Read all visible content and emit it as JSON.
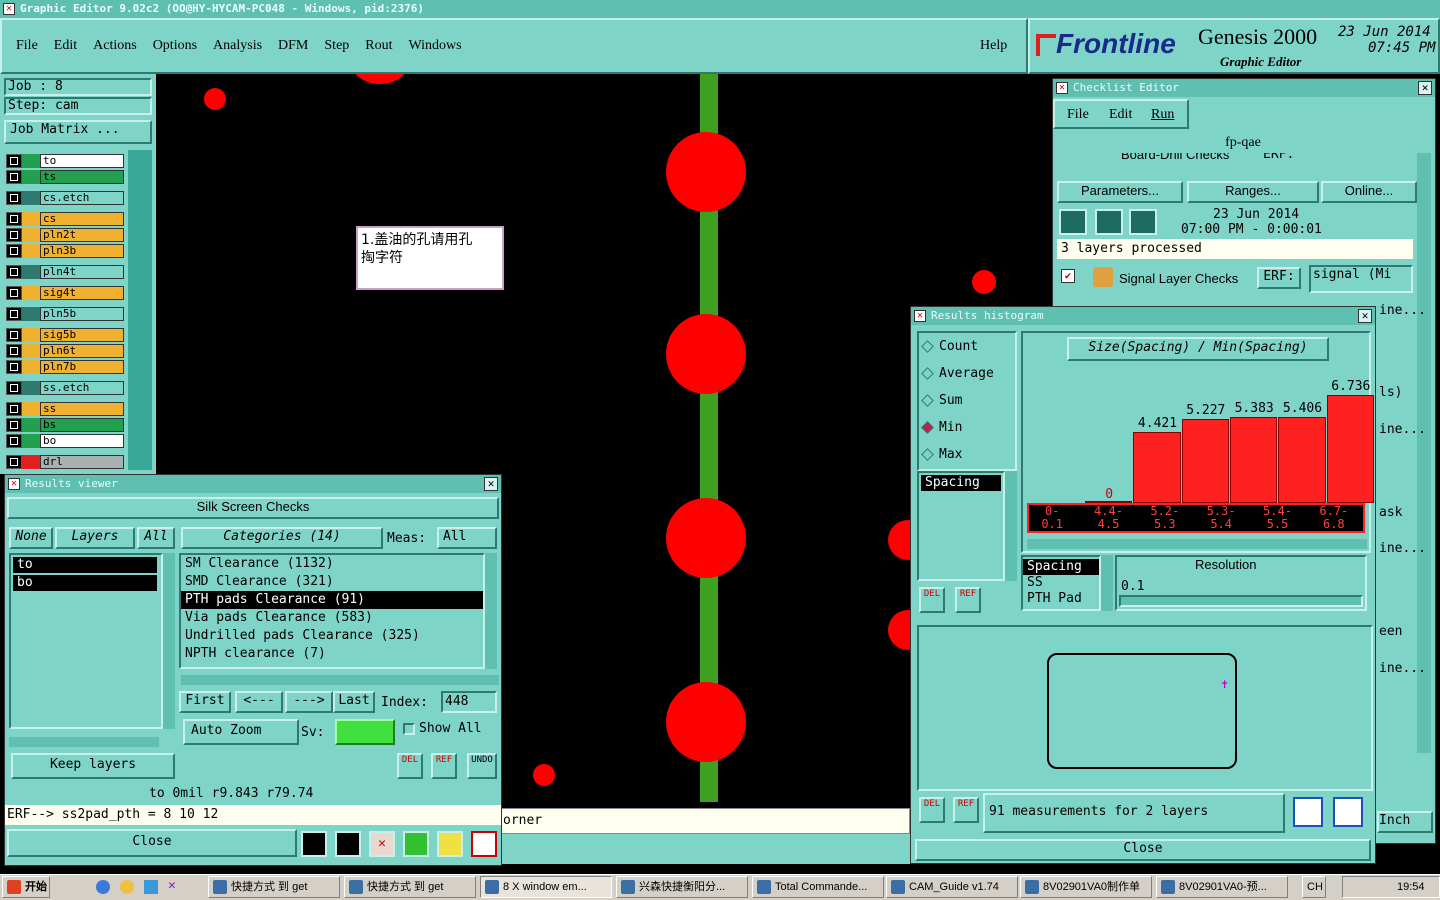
{
  "title_bar": "Graphic Editor 9.02c2 (OO@HY-HYCAM-PC048 - Windows, pid:2376)",
  "menu": [
    "File",
    "Edit",
    "Actions",
    "Options",
    "Analysis",
    "DFM",
    "Step",
    "Rout",
    "Windows"
  ],
  "help": "Help",
  "brand": {
    "logo": "Frontline",
    "product": "Genesis 2000",
    "subtitle": "Graphic Editor",
    "date": "23 Jun 2014",
    "time": "07:45 PM"
  },
  "job": {
    "job": "Job : 8",
    "step": "Step: cam",
    "matrix": "Job Matrix ..."
  },
  "layers": [
    "to",
    "ts",
    "cs.etch",
    "cs",
    "pln2t",
    "pln3b",
    "pln4t",
    "sig4t",
    "pln5b",
    "sig5b",
    "pln6t",
    "pln7b",
    "ss.etch",
    "ss",
    "bs",
    "bo",
    "drl"
  ],
  "canvas_note": {
    "line1": "1.盖油的孔请用孔",
    "line2": "掏字符"
  },
  "canvas_status": "orner",
  "results_viewer": {
    "title": "Results viewer",
    "header": "Silk Screen Checks",
    "none": "None",
    "layers_btn": "Layers",
    "all": "All",
    "layer_list": [
      "to",
      "bo"
    ],
    "categories": "Categories (14)",
    "meas_label": "Meas:",
    "meas_value": "All",
    "cat_list": [
      "SM Clearance (1132)",
      "SMD Clearance (321)",
      "PTH pads Clearance (91)",
      "Via pads Clearance (583)",
      "Undrilled pads Clearance (325)",
      "NPTH clearance (7)"
    ],
    "first": "First",
    "prev": "<---",
    "next": "--->",
    "last": "Last",
    "index_label": "Index:",
    "index_value": "448",
    "auto_zoom": "Auto Zoom",
    "sv_label": "Sv:",
    "show_all": "Show All",
    "keep_layers": "Keep layers",
    "del": "DEL",
    "ref": "REF",
    "undo": "UNDO",
    "info": "to 0mil  r9.843  r79.74",
    "erf": "ERF--> ss2pad_pth = 8 10 12",
    "close": "Close"
  },
  "checklist": {
    "title": "Checklist Editor",
    "menu": [
      "File",
      "Edit",
      "Run"
    ],
    "name": "fp-qae",
    "row1": "Board-Drill Checks",
    "erf": "ERF:",
    "params": "Parameters...",
    "ranges": "Ranges...",
    "online": "Online...",
    "date": "23 Jun 2014",
    "time": "07:00 PM - 0:00:01",
    "processed": "3 layers processed",
    "row2": "Signal Layer Checks",
    "row2_value": "signal (Mi",
    "side": [
      "ine...",
      "ls)",
      "ine...",
      "ask",
      "ine...",
      "een",
      "ine..."
    ],
    "inch": "Inch"
  },
  "histogram": {
    "title": "Results histogram",
    "options": [
      "Count",
      "Average",
      "Sum",
      "Min",
      "Max"
    ],
    "selected": "Min",
    "chart_title": "Size(Spacing) / Min(Spacing)",
    "list1": [
      "Spacing"
    ],
    "list2": [
      "Spacing",
      "SS",
      "PTH Pad"
    ],
    "resolution_label": "Resolution",
    "resolution_value": "0.1",
    "measurements": "91 measurements for 2 layers",
    "close": "Close",
    "del": "DEL",
    "ref": "REF"
  },
  "chart_data": {
    "type": "bar",
    "title": "Size(Spacing) / Min(Spacing)",
    "categories": [
      "0-\n0.1",
      "4.4-\n4.5",
      "5.2-\n5.3",
      "5.3-\n5.4",
      "5.4-\n5.5",
      "6.7-\n6.8"
    ],
    "cat_top": [
      "0-",
      "4.4-",
      "5.2-",
      "5.3-",
      "5.4-",
      "6.7-"
    ],
    "cat_bottom": [
      "0.1",
      "4.5",
      "5.3",
      "5.4",
      "5.5",
      "6.8"
    ],
    "values": [
      0,
      4.421,
      5.227,
      5.383,
      5.406,
      6.736
    ],
    "labels": [
      "0",
      "4.421",
      "5.227",
      "5.383",
      "5.406",
      "6.736"
    ],
    "ylim": [
      0,
      7.5
    ]
  },
  "taskbar": {
    "start": "开始",
    "items": [
      "快捷方式 到 get",
      "快捷方式 到 get",
      "8 X window em...",
      "兴森快捷衡阳分...",
      "Total Commande...",
      "CAM_Guide v1.74",
      "8V02901VA0制作单",
      "8V02901VA0-预..."
    ],
    "lang": "CH",
    "clock": "19:54"
  }
}
